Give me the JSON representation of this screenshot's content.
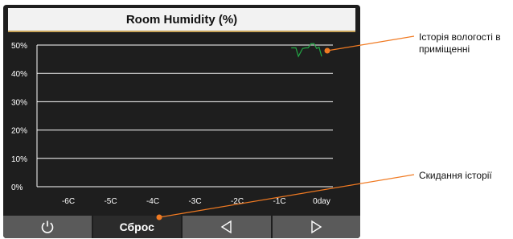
{
  "header": {
    "title": "Room Humidity (%)"
  },
  "chart_data": {
    "type": "line",
    "y_ticks": [
      "50%",
      "40%",
      "30%",
      "20%",
      "10%",
      "0%"
    ],
    "x_ticks": [
      "-6C",
      "-5C",
      "-4C",
      "-3C",
      "-2C",
      "-1C",
      "0day"
    ],
    "ylim": [
      0,
      50
    ],
    "grid": true,
    "series": [
      {
        "color": "#22a845",
        "x": [
          -0.72,
          -0.61,
          -0.55,
          -0.45,
          -0.38,
          -0.32,
          -0.25,
          -0.18,
          -0.12,
          -0.06,
          0
        ],
        "values": [
          49,
          49,
          46,
          48.8,
          49,
          49,
          50.5,
          50.5,
          48.8,
          49.2,
          46
        ]
      }
    ]
  },
  "toolbar": {
    "power_icon": "power-icon",
    "reset_label": "Сброс",
    "prev_icon": "triangle-left-icon",
    "next_icon": "triangle-right-icon"
  },
  "annotations": {
    "history_label": "Історія вологості в приміщенні",
    "reset_label": "Скидання історії",
    "marker_color": "#f07a22"
  }
}
